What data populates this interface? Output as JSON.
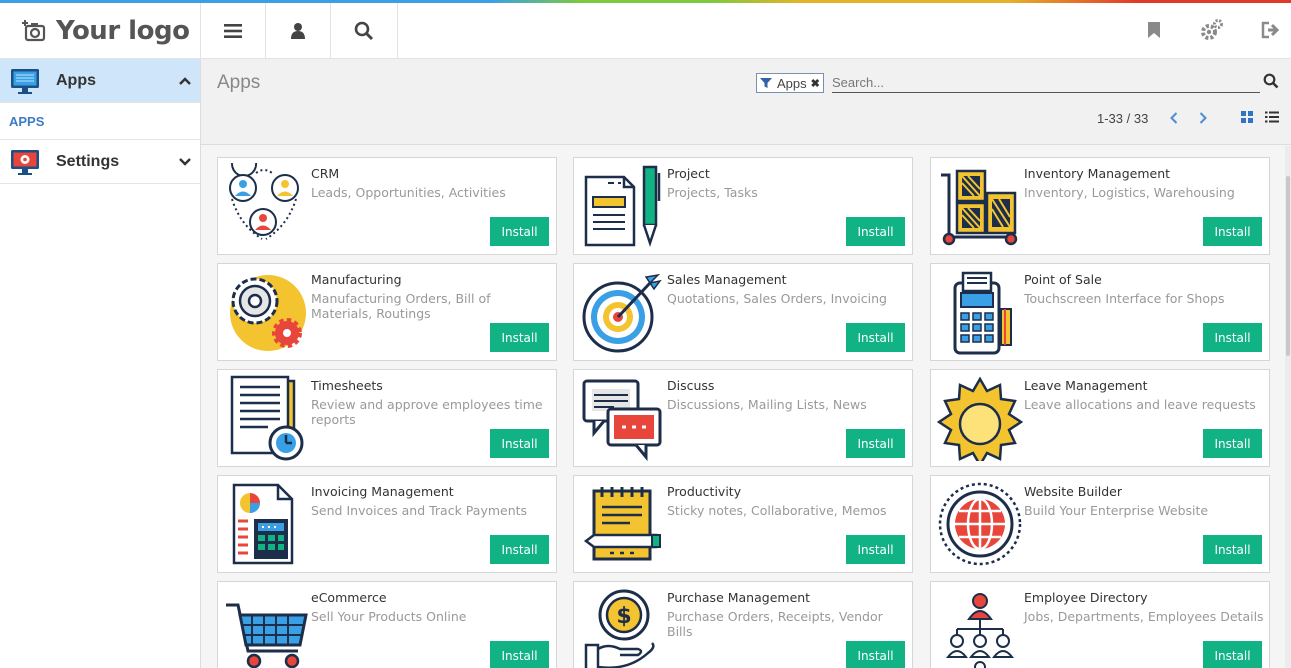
{
  "topbar": {
    "logo_text": "Your logo",
    "buttons": [
      {
        "name": "menu-toggle-button",
        "icon": "hamburger-icon"
      },
      {
        "name": "user-button",
        "icon": "user-icon"
      },
      {
        "name": "search-toggle-button",
        "icon": "search-icon"
      }
    ],
    "right_icons": [
      "bookmark-icon",
      "settings-gears-icon",
      "logout-icon"
    ]
  },
  "sidebar": {
    "items": [
      {
        "label": "Apps",
        "icon": "monitor-icon",
        "expanded": true
      },
      {
        "label": "Settings",
        "icon": "monitor-gear-icon",
        "expanded": false
      }
    ],
    "sub_item": "APPS"
  },
  "control": {
    "title": "Apps",
    "facet_label": "Apps",
    "search_placeholder": "Search...",
    "pager": "1-33 / 33"
  },
  "colors": {
    "accent": "#11b385",
    "sidebar_active": "#cfe5fa",
    "link": "#3c7cc6"
  },
  "apps": [
    {
      "name": "CRM",
      "desc": "Leads, Opportunities, Activities",
      "button": "Install",
      "icon": "crm-icon"
    },
    {
      "name": "Project",
      "desc": "Projects, Tasks",
      "button": "Install",
      "icon": "project-icon"
    },
    {
      "name": "Inventory Management",
      "desc": "Inventory, Logistics, Warehousing",
      "button": "Install",
      "icon": "inventory-icon"
    },
    {
      "name": "Manufacturing",
      "desc": "Manufacturing Orders, Bill of Materials, Routings",
      "button": "Install",
      "icon": "manufacturing-icon"
    },
    {
      "name": "Sales Management",
      "desc": "Quotations, Sales Orders, Invoicing",
      "button": "Install",
      "icon": "sales-target-icon"
    },
    {
      "name": "Point of Sale",
      "desc": "Touchscreen Interface for Shops",
      "button": "Install",
      "icon": "pos-terminal-icon"
    },
    {
      "name": "Timesheets",
      "desc": "Review and approve employees time reports",
      "button": "Install",
      "icon": "timesheet-icon"
    },
    {
      "name": "Discuss",
      "desc": "Discussions, Mailing Lists, News",
      "button": "Install",
      "icon": "discuss-icon"
    },
    {
      "name": "Leave Management",
      "desc": "Leave allocations and leave requests",
      "button": "Install",
      "icon": "sun-icon"
    },
    {
      "name": "Invoicing Management",
      "desc": "Send Invoices and Track Payments",
      "button": "Install",
      "icon": "invoice-calculator-icon"
    },
    {
      "name": "Productivity",
      "desc": "Sticky notes, Collaborative, Memos",
      "button": "Install",
      "icon": "notepad-icon"
    },
    {
      "name": "Website Builder",
      "desc": "Build Your Enterprise Website",
      "button": "Install",
      "icon": "globe-icon"
    },
    {
      "name": "eCommerce",
      "desc": "Sell Your Products Online",
      "button": "Install",
      "icon": "shopping-cart-icon"
    },
    {
      "name": "Purchase Management",
      "desc": "Purchase Orders, Receipts, Vendor Bills",
      "button": "Install",
      "icon": "coin-hand-icon"
    },
    {
      "name": "Employee Directory",
      "desc": "Jobs, Departments, Employees Details",
      "button": "Install",
      "icon": "org-chart-icon"
    }
  ]
}
